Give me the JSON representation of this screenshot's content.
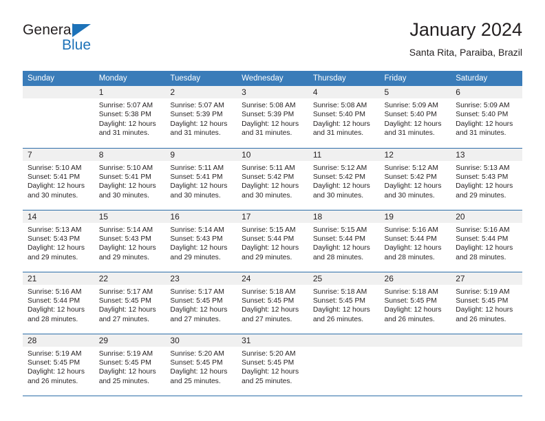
{
  "brand": {
    "name_part1": "General",
    "name_part2": "Blue",
    "triangle_icon": "triangle-icon",
    "accent_color": "#1d72b8"
  },
  "header": {
    "title": "January 2024",
    "subtitle": "Santa Rita, Paraiba, Brazil"
  },
  "theme": {
    "header_blue": "#3a7cb9",
    "row_divider_blue": "#2b6ca8",
    "daynum_band": "#f0f0f0"
  },
  "weekdays": [
    "Sunday",
    "Monday",
    "Tuesday",
    "Wednesday",
    "Thursday",
    "Friday",
    "Saturday"
  ],
  "weeks": [
    [
      {
        "day": "",
        "sunrise": "",
        "sunset": "",
        "daylight1": "",
        "daylight2": ""
      },
      {
        "day": "1",
        "sunrise": "Sunrise: 5:07 AM",
        "sunset": "Sunset: 5:38 PM",
        "daylight1": "Daylight: 12 hours",
        "daylight2": "and 31 minutes."
      },
      {
        "day": "2",
        "sunrise": "Sunrise: 5:07 AM",
        "sunset": "Sunset: 5:39 PM",
        "daylight1": "Daylight: 12 hours",
        "daylight2": "and 31 minutes."
      },
      {
        "day": "3",
        "sunrise": "Sunrise: 5:08 AM",
        "sunset": "Sunset: 5:39 PM",
        "daylight1": "Daylight: 12 hours",
        "daylight2": "and 31 minutes."
      },
      {
        "day": "4",
        "sunrise": "Sunrise: 5:08 AM",
        "sunset": "Sunset: 5:40 PM",
        "daylight1": "Daylight: 12 hours",
        "daylight2": "and 31 minutes."
      },
      {
        "day": "5",
        "sunrise": "Sunrise: 5:09 AM",
        "sunset": "Sunset: 5:40 PM",
        "daylight1": "Daylight: 12 hours",
        "daylight2": "and 31 minutes."
      },
      {
        "day": "6",
        "sunrise": "Sunrise: 5:09 AM",
        "sunset": "Sunset: 5:40 PM",
        "daylight1": "Daylight: 12 hours",
        "daylight2": "and 31 minutes."
      }
    ],
    [
      {
        "day": "7",
        "sunrise": "Sunrise: 5:10 AM",
        "sunset": "Sunset: 5:41 PM",
        "daylight1": "Daylight: 12 hours",
        "daylight2": "and 30 minutes."
      },
      {
        "day": "8",
        "sunrise": "Sunrise: 5:10 AM",
        "sunset": "Sunset: 5:41 PM",
        "daylight1": "Daylight: 12 hours",
        "daylight2": "and 30 minutes."
      },
      {
        "day": "9",
        "sunrise": "Sunrise: 5:11 AM",
        "sunset": "Sunset: 5:41 PM",
        "daylight1": "Daylight: 12 hours",
        "daylight2": "and 30 minutes."
      },
      {
        "day": "10",
        "sunrise": "Sunrise: 5:11 AM",
        "sunset": "Sunset: 5:42 PM",
        "daylight1": "Daylight: 12 hours",
        "daylight2": "and 30 minutes."
      },
      {
        "day": "11",
        "sunrise": "Sunrise: 5:12 AM",
        "sunset": "Sunset: 5:42 PM",
        "daylight1": "Daylight: 12 hours",
        "daylight2": "and 30 minutes."
      },
      {
        "day": "12",
        "sunrise": "Sunrise: 5:12 AM",
        "sunset": "Sunset: 5:42 PM",
        "daylight1": "Daylight: 12 hours",
        "daylight2": "and 30 minutes."
      },
      {
        "day": "13",
        "sunrise": "Sunrise: 5:13 AM",
        "sunset": "Sunset: 5:43 PM",
        "daylight1": "Daylight: 12 hours",
        "daylight2": "and 29 minutes."
      }
    ],
    [
      {
        "day": "14",
        "sunrise": "Sunrise: 5:13 AM",
        "sunset": "Sunset: 5:43 PM",
        "daylight1": "Daylight: 12 hours",
        "daylight2": "and 29 minutes."
      },
      {
        "day": "15",
        "sunrise": "Sunrise: 5:14 AM",
        "sunset": "Sunset: 5:43 PM",
        "daylight1": "Daylight: 12 hours",
        "daylight2": "and 29 minutes."
      },
      {
        "day": "16",
        "sunrise": "Sunrise: 5:14 AM",
        "sunset": "Sunset: 5:43 PM",
        "daylight1": "Daylight: 12 hours",
        "daylight2": "and 29 minutes."
      },
      {
        "day": "17",
        "sunrise": "Sunrise: 5:15 AM",
        "sunset": "Sunset: 5:44 PM",
        "daylight1": "Daylight: 12 hours",
        "daylight2": "and 29 minutes."
      },
      {
        "day": "18",
        "sunrise": "Sunrise: 5:15 AM",
        "sunset": "Sunset: 5:44 PM",
        "daylight1": "Daylight: 12 hours",
        "daylight2": "and 28 minutes."
      },
      {
        "day": "19",
        "sunrise": "Sunrise: 5:16 AM",
        "sunset": "Sunset: 5:44 PM",
        "daylight1": "Daylight: 12 hours",
        "daylight2": "and 28 minutes."
      },
      {
        "day": "20",
        "sunrise": "Sunrise: 5:16 AM",
        "sunset": "Sunset: 5:44 PM",
        "daylight1": "Daylight: 12 hours",
        "daylight2": "and 28 minutes."
      }
    ],
    [
      {
        "day": "21",
        "sunrise": "Sunrise: 5:16 AM",
        "sunset": "Sunset: 5:44 PM",
        "daylight1": "Daylight: 12 hours",
        "daylight2": "and 28 minutes."
      },
      {
        "day": "22",
        "sunrise": "Sunrise: 5:17 AM",
        "sunset": "Sunset: 5:45 PM",
        "daylight1": "Daylight: 12 hours",
        "daylight2": "and 27 minutes."
      },
      {
        "day": "23",
        "sunrise": "Sunrise: 5:17 AM",
        "sunset": "Sunset: 5:45 PM",
        "daylight1": "Daylight: 12 hours",
        "daylight2": "and 27 minutes."
      },
      {
        "day": "24",
        "sunrise": "Sunrise: 5:18 AM",
        "sunset": "Sunset: 5:45 PM",
        "daylight1": "Daylight: 12 hours",
        "daylight2": "and 27 minutes."
      },
      {
        "day": "25",
        "sunrise": "Sunrise: 5:18 AM",
        "sunset": "Sunset: 5:45 PM",
        "daylight1": "Daylight: 12 hours",
        "daylight2": "and 26 minutes."
      },
      {
        "day": "26",
        "sunrise": "Sunrise: 5:18 AM",
        "sunset": "Sunset: 5:45 PM",
        "daylight1": "Daylight: 12 hours",
        "daylight2": "and 26 minutes."
      },
      {
        "day": "27",
        "sunrise": "Sunrise: 5:19 AM",
        "sunset": "Sunset: 5:45 PM",
        "daylight1": "Daylight: 12 hours",
        "daylight2": "and 26 minutes."
      }
    ],
    [
      {
        "day": "28",
        "sunrise": "Sunrise: 5:19 AM",
        "sunset": "Sunset: 5:45 PM",
        "daylight1": "Daylight: 12 hours",
        "daylight2": "and 26 minutes."
      },
      {
        "day": "29",
        "sunrise": "Sunrise: 5:19 AM",
        "sunset": "Sunset: 5:45 PM",
        "daylight1": "Daylight: 12 hours",
        "daylight2": "and 25 minutes."
      },
      {
        "day": "30",
        "sunrise": "Sunrise: 5:20 AM",
        "sunset": "Sunset: 5:45 PM",
        "daylight1": "Daylight: 12 hours",
        "daylight2": "and 25 minutes."
      },
      {
        "day": "31",
        "sunrise": "Sunrise: 5:20 AM",
        "sunset": "Sunset: 5:45 PM",
        "daylight1": "Daylight: 12 hours",
        "daylight2": "and 25 minutes."
      },
      {
        "day": "",
        "sunrise": "",
        "sunset": "",
        "daylight1": "",
        "daylight2": ""
      },
      {
        "day": "",
        "sunrise": "",
        "sunset": "",
        "daylight1": "",
        "daylight2": ""
      },
      {
        "day": "",
        "sunrise": "",
        "sunset": "",
        "daylight1": "",
        "daylight2": ""
      }
    ]
  ]
}
